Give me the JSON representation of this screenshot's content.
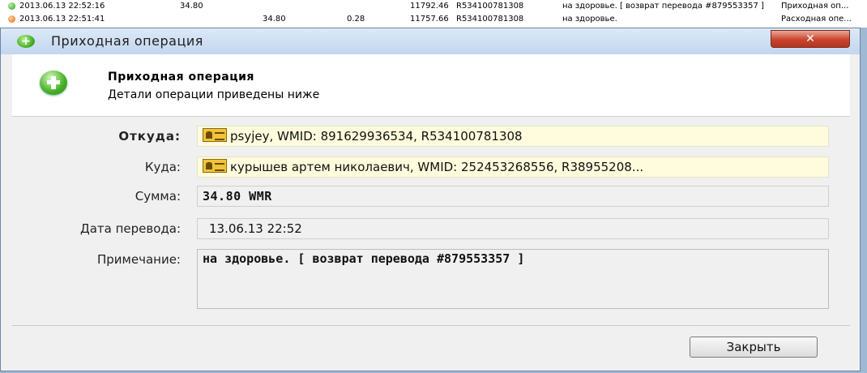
{
  "background_list": {
    "rows": [
      {
        "status": "green",
        "date": "2013.06.13 22:52:16",
        "income": "34.80",
        "expense": "",
        "fee": "",
        "balance": "11792.46",
        "purse": "R534100781308",
        "description": "на здоровье. [ возврат перевода #879553357 ]",
        "type": "Приходная оп..."
      },
      {
        "status": "orange",
        "date": "2013.06.13 22:51:41",
        "income": "",
        "expense": "34.80",
        "fee": "0.28",
        "balance": "11757.66",
        "purse": "R534100781308",
        "description": "на здоровье.",
        "type": "Расходная опе..."
      }
    ]
  },
  "window": {
    "title": "Приходная операция",
    "close_symbol": "✕"
  },
  "header": {
    "title": "Приходная операция",
    "subtitle": "Детали операции приведены ниже"
  },
  "fields": {
    "from_label": "Откуда:",
    "from_value": "psyjey, WMID: 891629936534, R534100781308",
    "to_label": "Куда:",
    "to_value": "курышев артем николаевич, WMID: 252453268556, R38955208...",
    "amount_label": "Сумма:",
    "amount_value": "34.80 WMR",
    "date_label": "Дата перевода:",
    "date_value": "13.06.13 22:52",
    "note_label": "Примечание:",
    "note_value": "на здоровье. [ возврат перевода #879553357 ]"
  },
  "buttons": {
    "close_label": "Закрыть"
  }
}
